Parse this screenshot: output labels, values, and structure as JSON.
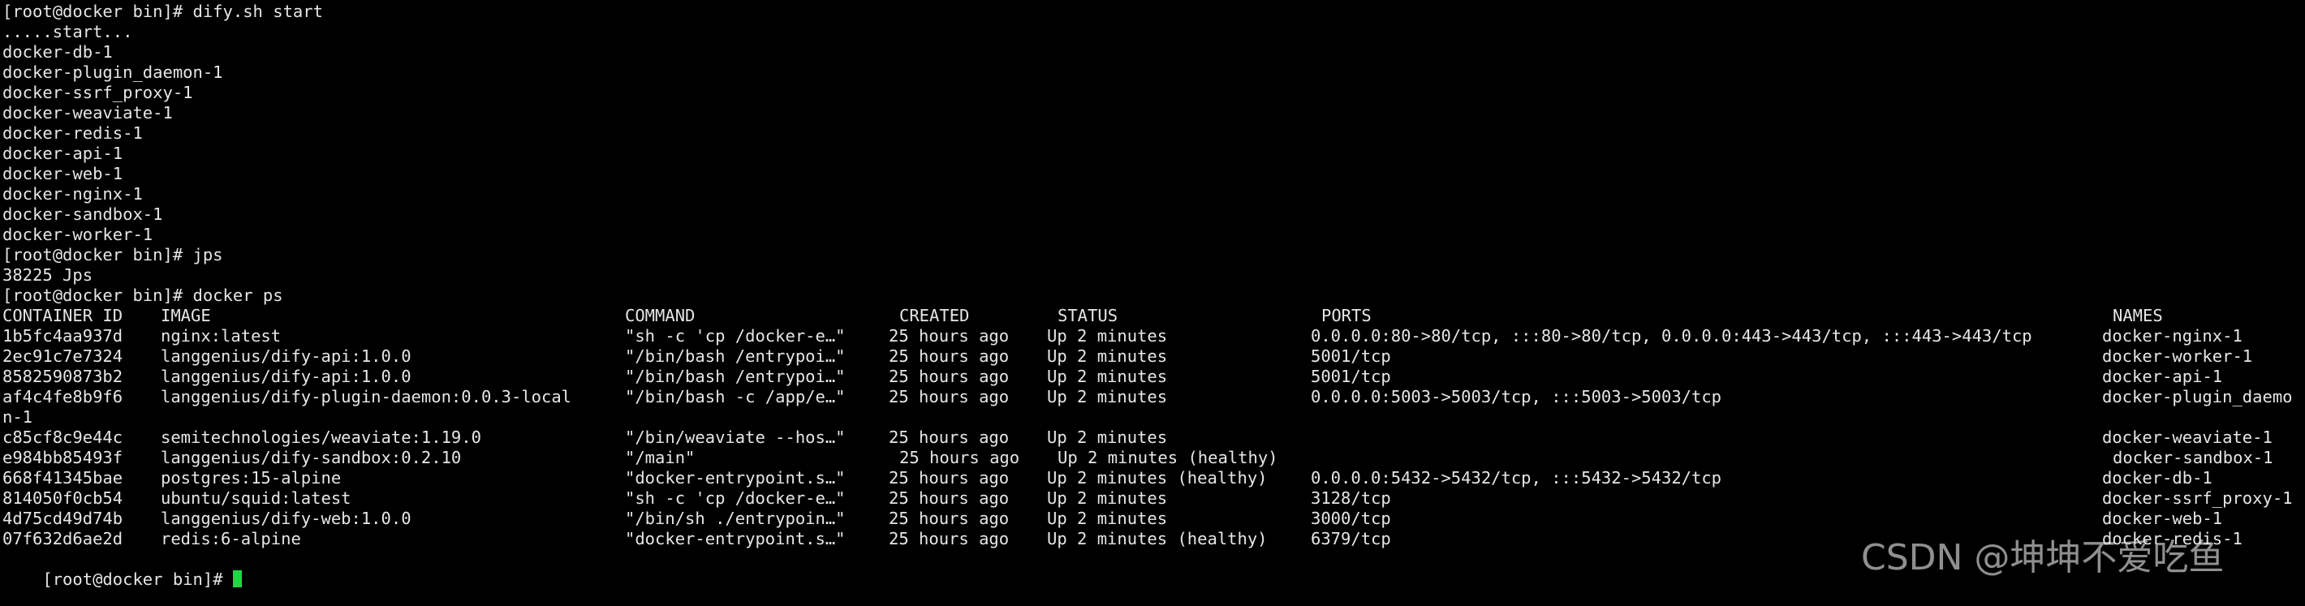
{
  "colors": {
    "background": "#000000",
    "foreground": "#e6e6e6",
    "cursor": "#22d644"
  },
  "session": [
    "[root@docker bin]# dify.sh start",
    ".....start...",
    "docker-db-1",
    "docker-plugin_daemon-1",
    "docker-ssrf_proxy-1",
    "docker-weaviate-1",
    "docker-redis-1",
    "docker-api-1",
    "docker-web-1",
    "docker-nginx-1",
    "docker-sandbox-1",
    "docker-worker-1",
    "[root@docker bin]# jps",
    "38225 Jps",
    "[root@docker bin]# docker ps"
  ],
  "docker_ps": {
    "header": {
      "id": "CONTAINER ID",
      "image": "IMAGE",
      "command": "COMMAND",
      "created": "CREATED",
      "status": "STATUS",
      "ports": "PORTS",
      "names": "NAMES"
    },
    "rows": [
      {
        "id": "1b5fc4aa937d",
        "image": "nginx:latest",
        "command": "\"sh -c 'cp /docker-e…\"",
        "created": "25 hours ago",
        "status": "Up 2 minutes",
        "ports": "0.0.0.0:80->80/tcp, :::80->80/tcp, 0.0.0.0:443->443/tcp, :::443->443/tcp",
        "names": "docker-nginx-1"
      },
      {
        "id": "2ec91c7e7324",
        "image": "langgenius/dify-api:1.0.0",
        "command": "\"/bin/bash /entrypoi…\"",
        "created": "25 hours ago",
        "status": "Up 2 minutes",
        "ports": "5001/tcp",
        "names": "docker-worker-1"
      },
      {
        "id": "8582590873b2",
        "image": "langgenius/dify-api:1.0.0",
        "command": "\"/bin/bash /entrypoi…\"",
        "created": "25 hours ago",
        "status": "Up 2 minutes",
        "ports": "5001/tcp",
        "names": "docker-api-1"
      },
      {
        "id": "af4c4fe8b9f6",
        "image": "langgenius/dify-plugin-daemon:0.0.3-local",
        "command": "\"/bin/bash -c /app/e…\"",
        "created": "25 hours ago",
        "status": "Up 2 minutes",
        "ports": "0.0.0.0:5003->5003/tcp, :::5003->5003/tcp",
        "names": "docker-plugin_daemo",
        "names_wrap": "n-1"
      },
      {
        "id": "c85cf8c9e44c",
        "image": "semitechnologies/weaviate:1.19.0",
        "command": "\"/bin/weaviate --hos…\"",
        "created": "25 hours ago",
        "status": "Up 2 minutes",
        "ports": "",
        "names": "docker-weaviate-1"
      },
      {
        "id": "e984bb85493f",
        "image": "langgenius/dify-sandbox:0.2.10",
        "command": "\"/main\"",
        "created": "25 hours ago",
        "status": "Up 2 minutes (healthy)",
        "ports": "",
        "names": "docker-sandbox-1"
      },
      {
        "id": "668f41345bae",
        "image": "postgres:15-alpine",
        "command": "\"docker-entrypoint.s…\"",
        "created": "25 hours ago",
        "status": "Up 2 minutes (healthy)",
        "ports": "0.0.0.0:5432->5432/tcp, :::5432->5432/tcp",
        "names": "docker-db-1"
      },
      {
        "id": "814050f0cb54",
        "image": "ubuntu/squid:latest",
        "command": "\"sh -c 'cp /docker-e…\"",
        "created": "25 hours ago",
        "status": "Up 2 minutes",
        "ports": "3128/tcp",
        "names": "docker-ssrf_proxy-1"
      },
      {
        "id": "4d75cd49d74b",
        "image": "langgenius/dify-web:1.0.0",
        "command": "\"/bin/sh ./entrypoin…\"",
        "created": "25 hours ago",
        "status": "Up 2 minutes",
        "ports": "3000/tcp",
        "names": "docker-web-1"
      },
      {
        "id": "07f632d6ae2d",
        "image": "redis:6-alpine",
        "command": "\"docker-entrypoint.s…\"",
        "created": "25 hours ago",
        "status": "Up 2 minutes (healthy)",
        "ports": "6379/tcp",
        "names": "docker-redis-1"
      }
    ]
  },
  "prompt": "[root@docker bin]# ",
  "watermark": "CSDN @坤坤不爱吃鱼"
}
